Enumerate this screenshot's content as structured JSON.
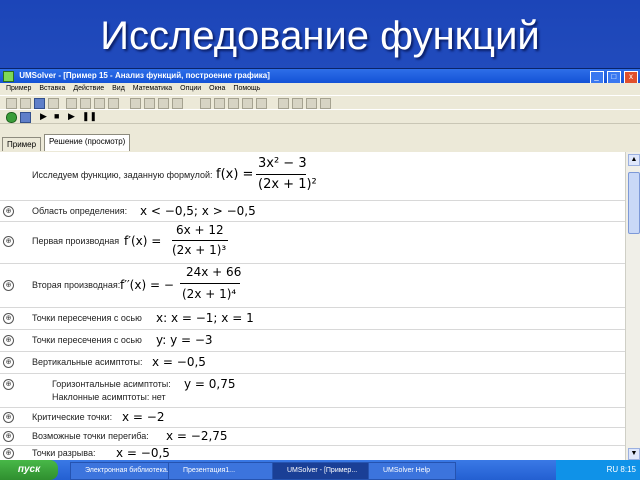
{
  "slide": {
    "title": "Исследование функций"
  },
  "window": {
    "title": "UMSolver - [Пример 15 - Анализ функций, построение графика]",
    "controls": {
      "min": "_",
      "max": "□",
      "close": "x"
    }
  },
  "menu": [
    "Пример",
    "Вставка",
    "Действие",
    "Вид",
    "Математика",
    "Опции",
    "Окна",
    "Помощь"
  ],
  "tabs": {
    "example": "Пример",
    "solution": "Решение (просмотр)"
  },
  "content": {
    "intro_label": "Исследуем функцию, заданную формулой:",
    "fx": "f(x) =",
    "fx_num": "3x² − 3",
    "fx_den": "(2x + 1)²",
    "domain_label": "Область определения:",
    "domain_value": "x < −0,5;  x > −0,5",
    "d1_label": "Первая производная",
    "d1_fx": "f′(x) =",
    "d1_num": "6x + 12",
    "d1_den": "(2x + 1)³",
    "d2_label": "Вторая производная:",
    "d2_fx": "f′′(x) = −",
    "d2_num": "24x + 66",
    "d2_den": "(2x + 1)⁴",
    "ox_label": "Точки пересечения с осью",
    "ox_value": "x:  x = −1;  x = 1",
    "oy_label": "Точки пересечения с осью",
    "oy_value": "y:  y = −3",
    "vert_label": "Вертикальные асимптоты:",
    "vert_value": "x = −0,5",
    "horiz_label": "Горизонтальные асимптоты:",
    "horiz_value": "y = 0,75",
    "incl_label": "Наклонные асимптоты: нет",
    "crit_label": "Критические точки:",
    "crit_value": "x = −2",
    "infl_label": "Возможные точки перегиба:",
    "infl_value": "x = −2,75",
    "break_label": "Точки разрыва:",
    "break_value": "x = −0,5",
    "row_icon": "⊕"
  },
  "taskbar": {
    "start": "пуск",
    "tasks": [
      "Электронная библиотека...",
      "Презентация1...",
      "UMSolver - [Пример...",
      "UMSolver Help"
    ],
    "clock": "RU  8:15"
  }
}
